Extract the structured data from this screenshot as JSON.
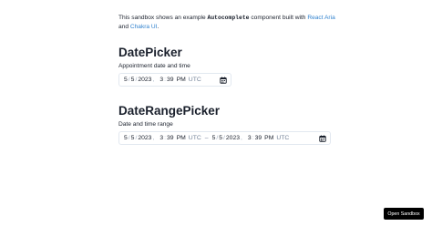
{
  "intro": {
    "text_before": "This sandbox shows an example ",
    "code": "Autocomplete",
    "text_middle": " component built with ",
    "link_react_aria": "React Aria",
    "text_and": "and ",
    "link_chakra": "Chakra UI",
    "text_end": "."
  },
  "datepicker": {
    "title": "DatePicker",
    "label": "Appointment date and time",
    "value": {
      "month": "5",
      "day": "5",
      "year": "2023",
      "hour": "3",
      "minute": "39",
      "ampm": "PM",
      "tz": "UTC"
    },
    "calendar_icon": "calendar-icon"
  },
  "daterangepicker": {
    "title": "DateRangePicker",
    "label": "Date and time range",
    "start": {
      "month": "5",
      "day": "5",
      "year": "2023",
      "hour": "3",
      "minute": "39",
      "ampm": "PM",
      "tz": "UTC"
    },
    "range_separator": "–",
    "end": {
      "month": "5",
      "day": "5",
      "year": "2023",
      "hour": "3",
      "minute": "39",
      "ampm": "PM",
      "tz": "UTC"
    },
    "calendar_icon": "calendar-icon"
  },
  "sep": {
    "slash": "/",
    "comma": ",",
    "colon": ":"
  },
  "open_sandbox_label": "Open Sandbox"
}
